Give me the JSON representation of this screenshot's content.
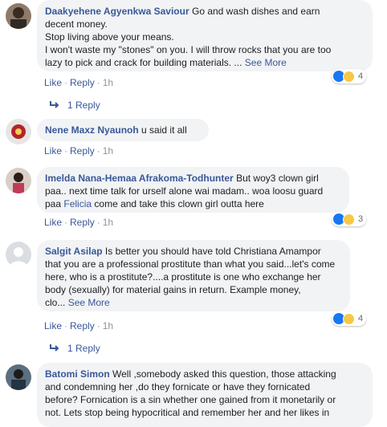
{
  "action_labels": {
    "like": "Like",
    "reply": "Reply",
    "sep": "·"
  },
  "comments": [
    {
      "author": "Daakyehene Agyenkwa Saviour",
      "text_lines": [
        "Go and wash dishes and earn",
        "decent money.",
        "Stop living above your means.",
        "I won't waste my \"stones\" on you. I will throw rocks that you are too",
        "lazy to pick and crack for building materials. ..."
      ],
      "see_more": "See More",
      "time": "1h",
      "reactions_count": "4",
      "replies_label": "1 Reply"
    },
    {
      "author": "Nene Maxz Nyaunoh",
      "text_lines": [
        "u said it all"
      ],
      "time": "1h"
    },
    {
      "author": "Imelda Nana-Hemaa Afrakoma-Todhunter",
      "text_lines": [
        "But woy3 clown girl",
        "paa.. next time talk for urself alone wai madam.. woa loosu guard",
        "paa",
        "come and take this clown girl outta here"
      ],
      "mention": "Felicia",
      "time": "1h",
      "reactions_count": "3"
    },
    {
      "author": "Salgit Asilap",
      "text_lines": [
        "Is better you should have told Christiana Amampor",
        "that you are a professional prostitute than what you said...let's come",
        "here, who is a prostitute?....a prostitute is one who exchange her",
        "body (sexually) for material gains in return. Example money,",
        "clo..."
      ],
      "see_more": "See More",
      "time": "1h",
      "reactions_count": "4",
      "replies_label": "1 Reply"
    },
    {
      "author": "Batomi Simon",
      "text_lines": [
        "Well ,somebody asked this question, those attacking",
        "and condemning her ,do they fornicate or have they fornicated",
        "before? Fornication is a sin whether one gained from it monetarily or",
        "not. Lets stop being hypocritical and remember her and her likes in"
      ]
    }
  ]
}
